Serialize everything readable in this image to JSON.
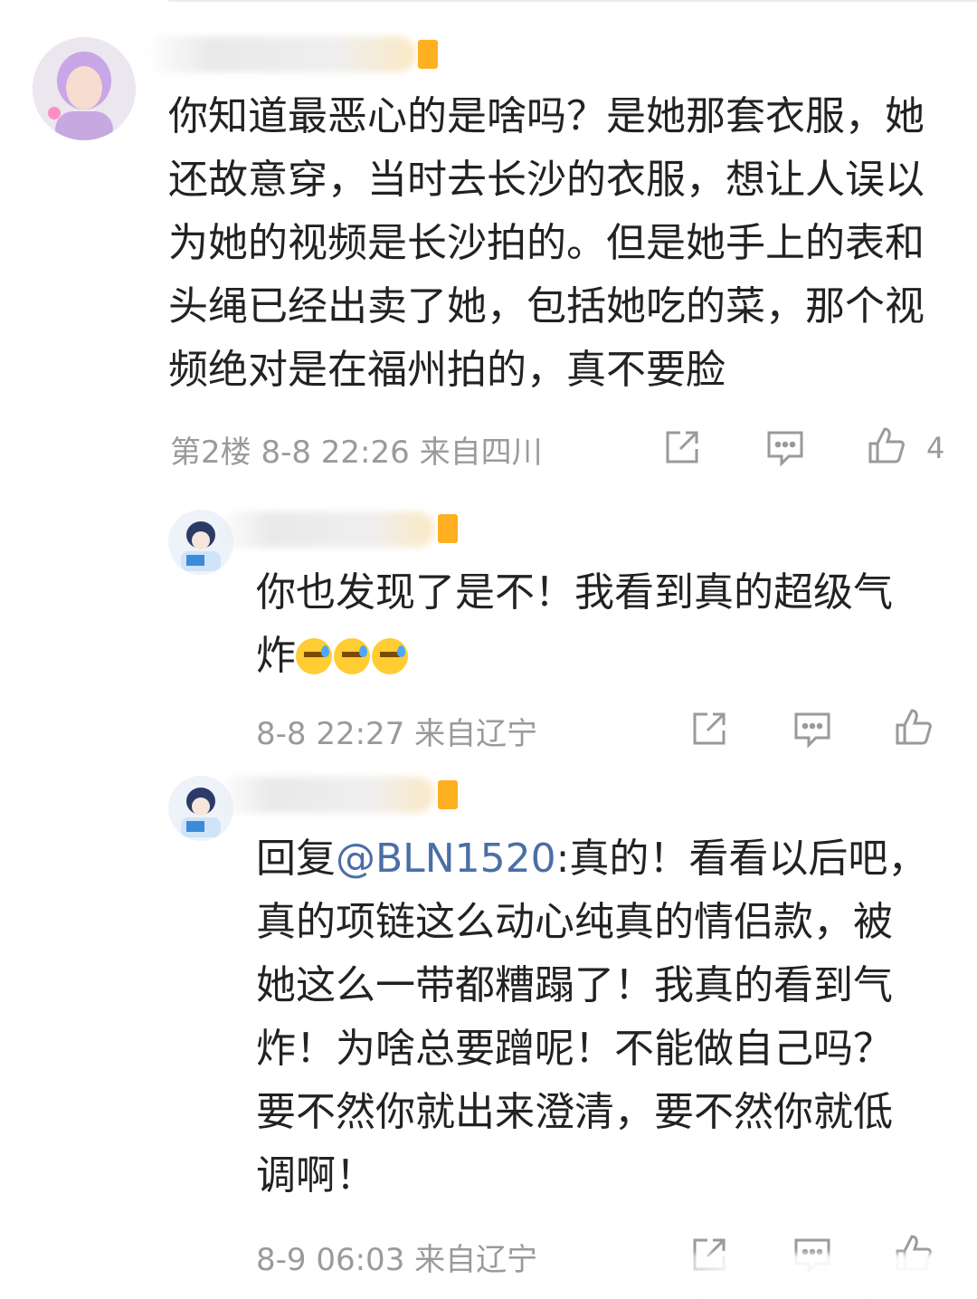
{
  "comments": [
    {
      "text_lines": [
        "你知道最恶心的是啥吗？是她那套衣服，她",
        "还故意穿，当时去长沙的衣服，想让人误以",
        "为她的视频是长沙拍的。但是她手上的表和",
        "头绳已经出卖了她，包括她吃的菜，那个视",
        "频绝对是在福州拍的，真不要脸"
      ],
      "meta": "第2楼  8-8 22:26  来自四川",
      "like_count": "4"
    },
    {
      "text_lines": [
        "你也发现了是不！我看到真的超级气",
        "炸"
      ],
      "meta": "8-8 22:27  来自辽宁"
    },
    {
      "reply_prefix": "回复",
      "mention": "@BLN1520",
      "first_line_rest": ":真的！看看以后吧，",
      "text_lines": [
        "真的项链这么动心纯真的情侣款，被",
        "她这么一带都糟蹋了！我真的看到气",
        "炸！为啥总要蹭呢！不能做自己吗？",
        "要不然你就出来澄清，要不然你就低",
        "调啊！"
      ],
      "meta": "8-9 06:03  来自辽宁"
    }
  ],
  "icons": {
    "share": "share-icon",
    "reply": "comment-icon",
    "like": "thumbs-up-icon",
    "emoji": "sweat-face-emoji"
  },
  "colors": {
    "text": "#222222",
    "meta": "#9a9a9a",
    "mention": "#4a6fa5",
    "badge": "#ffb020"
  }
}
